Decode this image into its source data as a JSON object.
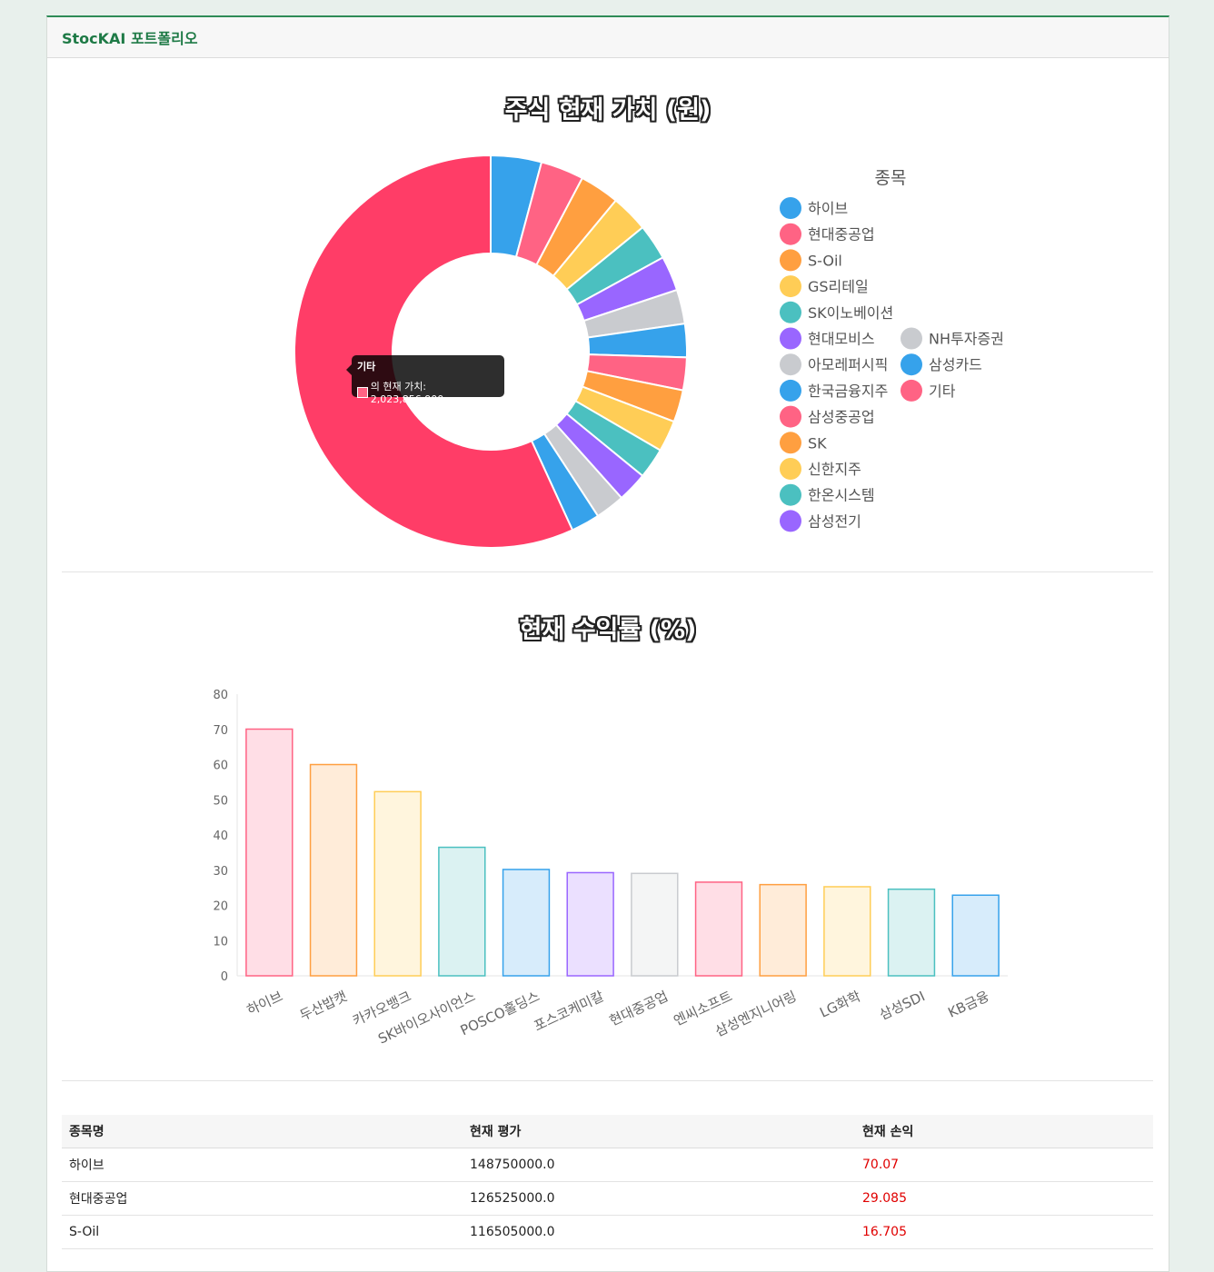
{
  "header": {
    "brand": "StocKAI 포트폴리오"
  },
  "chart_data": [
    {
      "type": "pie",
      "title": "주식 현재 가치 (원)",
      "legend_title": "종목",
      "legend_position": "right",
      "labels": [
        "하이브",
        "현대중공업",
        "S-Oil",
        "GS리테일",
        "SK이노베이션",
        "현대모비스",
        "아모레퍼시픽",
        "한국금융지주",
        "삼성중공업",
        "SK",
        "신한지주",
        "한온시스템",
        "삼성전기",
        "NH투자증권",
        "삼성카드",
        "기타"
      ],
      "values": [
        148750000,
        126525000,
        116505000,
        110000000,
        105000000,
        102000000,
        100000000,
        98000000,
        96000000,
        94000000,
        92000000,
        90000000,
        88000000,
        86000000,
        84000000,
        2023856900
      ],
      "colors": [
        "#36a2eb",
        "#ff6384",
        "#ff9f40",
        "#ffcd56",
        "#4bc0c0",
        "#9966ff",
        "#c9cbcf",
        "#36a2eb",
        "#ff6384",
        "#ff9f40",
        "#ffcd56",
        "#4bc0c0",
        "#9966ff",
        "#c9cbcf",
        "#36a2eb",
        "#ff6384"
      ],
      "highlight_color": "#ff3d67",
      "tooltip": {
        "title": "기타",
        "body": "의 현재 가치: 2,023,856,900"
      }
    },
    {
      "type": "bar",
      "title": "현재 수익률 (%)",
      "categories": [
        "하이브",
        "두산밥캣",
        "카카오뱅크",
        "SK바이오사이언스",
        "POSCO홀딩스",
        "포스코케미칼",
        "현대중공업",
        "엔씨소프트",
        "삼성엔지니어링",
        "LG화학",
        "삼성SDI",
        "KB금융"
      ],
      "values": [
        70.07,
        60,
        52.3,
        36.5,
        30.2,
        29.3,
        29.085,
        26.6,
        25.9,
        25.3,
        24.6,
        22.9
      ],
      "ylim": [
        0,
        80
      ],
      "yticks": [
        "80",
        "70",
        "60",
        "50",
        "40",
        "30",
        "20",
        "10",
        "0"
      ],
      "bar_fills": [
        "#ffdee6",
        "#ffecd9",
        "#fff5dd",
        "#dbf2f2",
        "#d7ecfb",
        "#ebe0ff",
        "#f4f5f5",
        "#ffdee6",
        "#ffecd9",
        "#fff5dd",
        "#dbf2f2",
        "#d7ecfb"
      ],
      "bar_strokes": [
        "#ff6384",
        "#ff9f40",
        "#ffcd56",
        "#4bc0c0",
        "#36a2eb",
        "#9966ff",
        "#c9cbcf",
        "#ff6384",
        "#ff9f40",
        "#ffcd56",
        "#4bc0c0",
        "#36a2eb"
      ]
    }
  ],
  "table": {
    "headers": [
      "종목명",
      "현재 평가",
      "현재 손익"
    ],
    "rows": [
      [
        "하이브",
        "148750000.0",
        "70.07"
      ],
      [
        "현대중공업",
        "126525000.0",
        "29.085"
      ],
      [
        "S-Oil",
        "116505000.0",
        "16.705"
      ]
    ]
  }
}
